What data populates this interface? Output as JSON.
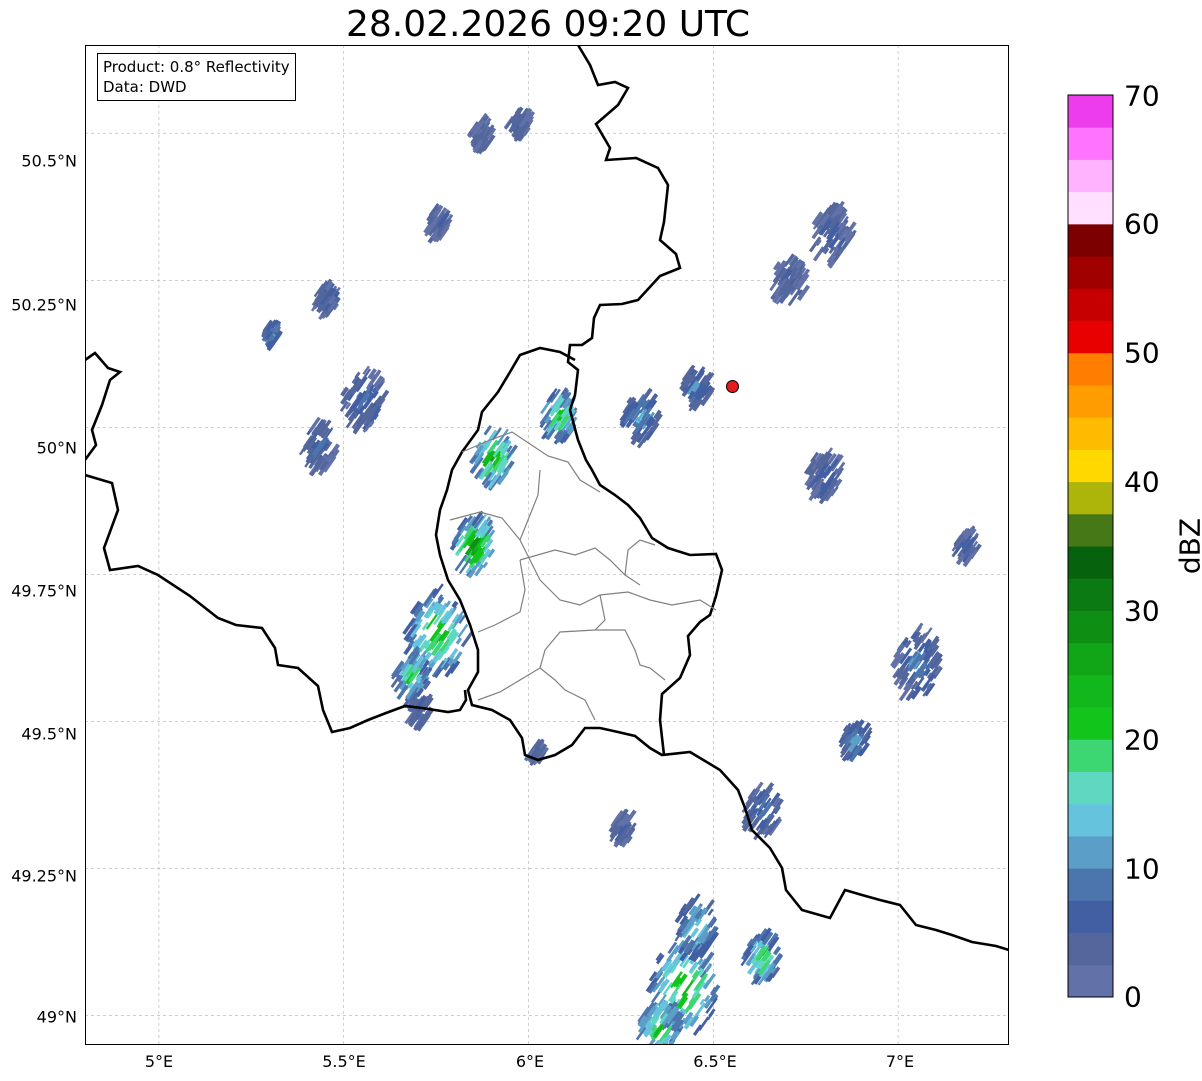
{
  "title": "28.02.2026 09:20 UTC",
  "info": {
    "product": "Product: 0.8° Reflectivity",
    "data": "Data: DWD"
  },
  "axes": {
    "lon_range": [
      4.8,
      7.3
    ],
    "lat_range": [
      48.95,
      50.65
    ],
    "lon_ticks": [
      "5°E",
      "5.5°E",
      "6°E",
      "6.5°E",
      "7°E"
    ],
    "lat_ticks": [
      "49°N",
      "49.25°N",
      "49.5°N",
      "49.75°N",
      "50°N",
      "50.25°N",
      "50.5°N"
    ],
    "grid": true
  },
  "colorbar": {
    "label": "dBZ",
    "ticks": [
      "0",
      "10",
      "20",
      "30",
      "40",
      "50",
      "60",
      "70"
    ],
    "range": [
      0,
      70
    ],
    "colors": [
      "#6272a8",
      "#54679d",
      "#435fa3",
      "#4c75ad",
      "#5b9ec8",
      "#65c3de",
      "#5fd8c2",
      "#3cd672",
      "#12c51b",
      "#12b81b",
      "#10a617",
      "#0e8f14",
      "#0b7a12",
      "#07620e",
      "#477817",
      "#aeb50a",
      "#ffd800",
      "#ffbb00",
      "#ff9d00",
      "#ff7d00",
      "#e80000",
      "#c60000",
      "#a00000",
      "#7c0000",
      "#ffe0ff",
      "#ffb3ff",
      "#ff74ff",
      "#ec3cec"
    ]
  },
  "station": {
    "name": "radar-site",
    "lon": 6.55,
    "lat": 50.11,
    "color": "#e8191d"
  },
  "map_colors": {
    "country_border": "#000000",
    "admin_border": "#808080",
    "light_echo": "#4c75ad",
    "moderate_echo": "#12b81b",
    "strong_echo": "#0b7a12"
  },
  "echo_regions": [
    {
      "lon": 5.9,
      "lat": 49.95,
      "size": 0.06,
      "intensity": 26
    },
    {
      "lon": 6.08,
      "lat": 50.02,
      "size": 0.05,
      "intensity": 22
    },
    {
      "lon": 5.85,
      "lat": 49.8,
      "size": 0.06,
      "intensity": 28
    },
    {
      "lon": 5.75,
      "lat": 49.65,
      "size": 0.09,
      "intensity": 24
    },
    {
      "lon": 5.68,
      "lat": 49.58,
      "size": 0.05,
      "intensity": 20
    },
    {
      "lon": 6.42,
      "lat": 49.05,
      "size": 0.1,
      "intensity": 24
    },
    {
      "lon": 6.45,
      "lat": 49.15,
      "size": 0.06,
      "intensity": 16
    },
    {
      "lon": 6.63,
      "lat": 49.1,
      "size": 0.05,
      "intensity": 22
    },
    {
      "lon": 6.35,
      "lat": 48.98,
      "size": 0.06,
      "intensity": 23
    },
    {
      "lon": 7.05,
      "lat": 49.6,
      "size": 0.07,
      "intensity": 10
    },
    {
      "lon": 6.88,
      "lat": 49.47,
      "size": 0.04,
      "intensity": 12
    },
    {
      "lon": 6.63,
      "lat": 49.35,
      "size": 0.05,
      "intensity": 10
    },
    {
      "lon": 5.55,
      "lat": 50.05,
      "size": 0.06,
      "intensity": 9
    },
    {
      "lon": 5.43,
      "lat": 49.97,
      "size": 0.05,
      "intensity": 8
    },
    {
      "lon": 6.3,
      "lat": 50.02,
      "size": 0.05,
      "intensity": 12
    },
    {
      "lon": 6.45,
      "lat": 50.07,
      "size": 0.04,
      "intensity": 10
    },
    {
      "lon": 6.82,
      "lat": 50.33,
      "size": 0.06,
      "intensity": 6
    },
    {
      "lon": 6.7,
      "lat": 50.25,
      "size": 0.05,
      "intensity": 5
    },
    {
      "lon": 5.75,
      "lat": 50.35,
      "size": 0.03,
      "intensity": 6
    },
    {
      "lon": 5.45,
      "lat": 50.22,
      "size": 0.03,
      "intensity": 6
    },
    {
      "lon": 5.3,
      "lat": 50.16,
      "size": 0.02,
      "intensity": 12
    },
    {
      "lon": 5.87,
      "lat": 50.5,
      "size": 0.03,
      "intensity": 5
    },
    {
      "lon": 5.97,
      "lat": 50.52,
      "size": 0.03,
      "intensity": 5
    },
    {
      "lon": 6.8,
      "lat": 49.92,
      "size": 0.05,
      "intensity": 6
    },
    {
      "lon": 7.18,
      "lat": 49.8,
      "size": 0.03,
      "intensity": 6
    },
    {
      "lon": 6.25,
      "lat": 49.32,
      "size": 0.03,
      "intensity": 6
    },
    {
      "lon": 6.02,
      "lat": 49.45,
      "size": 0.02,
      "intensity": 5
    },
    {
      "lon": 5.7,
      "lat": 49.52,
      "size": 0.03,
      "intensity": 8
    }
  ]
}
